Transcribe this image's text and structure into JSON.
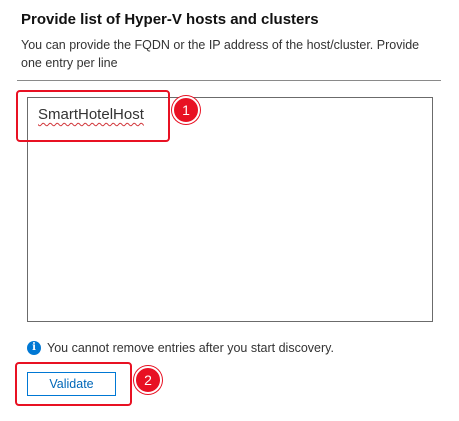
{
  "header": {
    "title": "Provide list of Hyper-V hosts and clusters",
    "description": "You can provide the FQDN or the IP address of the host/cluster. Provide one entry per line"
  },
  "entries": {
    "value": "SmartHotelHost"
  },
  "callouts": {
    "badge_1": "1",
    "badge_2": "2"
  },
  "info": {
    "icon": "info-icon",
    "text": "You cannot remove entries after you start discovery."
  },
  "actions": {
    "validate_label": "Validate"
  },
  "colors": {
    "accent": "#0078d4",
    "callout": "#e81123",
    "spellcheck": "#d13438"
  }
}
